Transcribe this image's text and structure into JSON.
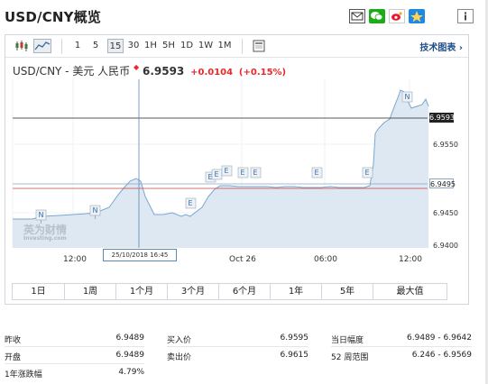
{
  "title": "USD/CNY概览",
  "share_icons": [
    "mail-icon",
    "wechat-icon",
    "weibo-icon",
    "qzone-icon"
  ],
  "toolbar": {
    "chart_types": [
      "candlestick-icon",
      "area-chart-icon"
    ],
    "intervals": [
      "1",
      "5",
      "15",
      "30",
      "1H",
      "5H",
      "1D",
      "1W",
      "1M"
    ],
    "active_interval": "15",
    "technical_link": "技术图表"
  },
  "quote": {
    "name": "USD/CNY - 美元 人民币",
    "price": "6.9593",
    "change": "+0.0104",
    "change_pct": "(+0.15%)"
  },
  "chart_data": {
    "type": "area",
    "y_ticks": [
      "6.9550",
      "6.9450",
      "6.9400"
    ],
    "x_ticks": [
      "12:00",
      "Oct 26",
      "06:00",
      "12:00"
    ],
    "last_price_tag": "6.9593",
    "level_tag": "6.9495",
    "crosshair_label": "25/10/2018 16:45",
    "markers": [
      "N",
      "N",
      "E",
      "E",
      "E",
      "E",
      "E",
      "E",
      "E",
      "E",
      "N"
    ],
    "watermark_cn": "英为财情",
    "watermark_en": "Investing.com"
  },
  "periods": [
    "1日",
    "1周",
    "1个月",
    "3个月",
    "6个月",
    "1年",
    "5年",
    "最大值"
  ],
  "stats": {
    "prev_close_label": "昨收",
    "prev_close": "6.9489",
    "open_label": "开盘",
    "open": "6.9489",
    "year_change_label": "1年涨跌幅",
    "year_change": "4.79%",
    "bid_label": "买入价",
    "bid": "6.9595",
    "ask_label": "卖出价",
    "ask": "6.9615",
    "day_range_label": "当日幅度",
    "day_range": "6.9489 - 6.9642",
    "week52_label": "52 周范围",
    "week52": "6.246 - 6.9569"
  },
  "colors": {
    "up": "#e8282a",
    "link": "#1f4e8c",
    "area": "#dde8f2",
    "line": "#7aa6cf"
  }
}
